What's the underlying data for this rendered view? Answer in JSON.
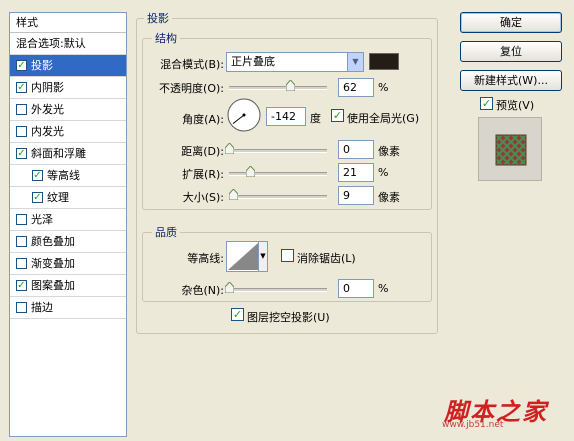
{
  "styles_list": {
    "header": "样式",
    "items": [
      {
        "label": "混合选项:默认",
        "checkbox": false,
        "checked": false,
        "indent": 0,
        "selected": false
      },
      {
        "label": "投影",
        "checkbox": true,
        "checked": true,
        "indent": 0,
        "selected": true
      },
      {
        "label": "内阴影",
        "checkbox": true,
        "checked": true,
        "indent": 0,
        "selected": false
      },
      {
        "label": "外发光",
        "checkbox": true,
        "checked": false,
        "indent": 0,
        "selected": false
      },
      {
        "label": "内发光",
        "checkbox": true,
        "checked": false,
        "indent": 0,
        "selected": false
      },
      {
        "label": "斜面和浮雕",
        "checkbox": true,
        "checked": true,
        "indent": 0,
        "selected": false
      },
      {
        "label": "等高线",
        "checkbox": true,
        "checked": true,
        "indent": 1,
        "selected": false
      },
      {
        "label": "纹理",
        "checkbox": true,
        "checked": true,
        "indent": 1,
        "selected": false
      },
      {
        "label": "光泽",
        "checkbox": true,
        "checked": false,
        "indent": 0,
        "selected": false
      },
      {
        "label": "颜色叠加",
        "checkbox": true,
        "checked": false,
        "indent": 0,
        "selected": false
      },
      {
        "label": "渐变叠加",
        "checkbox": true,
        "checked": false,
        "indent": 0,
        "selected": false
      },
      {
        "label": "图案叠加",
        "checkbox": true,
        "checked": true,
        "indent": 0,
        "selected": false
      },
      {
        "label": "描边",
        "checkbox": true,
        "checked": false,
        "indent": 0,
        "selected": false
      }
    ]
  },
  "drop_shadow": {
    "title": "投影",
    "structure": {
      "title": "结构",
      "blend_mode_label": "混合模式(B):",
      "blend_mode_value": "正片叠底",
      "shadow_color": "#231c17",
      "opacity_label": "不透明度(O):",
      "opacity_value": "62",
      "opacity_unit": "%",
      "angle_label": "角度(A):",
      "angle_value": "-142",
      "angle_unit": "度",
      "global_light_label": "使用全局光(G)",
      "global_light_checked": true,
      "distance_label": "距离(D):",
      "distance_value": "0",
      "distance_unit": "像素",
      "spread_label": "扩展(R):",
      "spread_value": "21",
      "spread_unit": "%",
      "size_label": "大小(S):",
      "size_value": "9",
      "size_unit": "像素"
    },
    "quality": {
      "title": "品质",
      "contour_label": "等高线:",
      "antialias_label": "消除锯齿(L)",
      "antialias_checked": false,
      "noise_label": "杂色(N):",
      "noise_value": "0",
      "noise_unit": "%"
    },
    "knockout_label": "图层挖空投影(U)",
    "knockout_checked": true
  },
  "buttons": {
    "ok": "确定",
    "reset": "复位",
    "new_style": "新建样式(W)...",
    "preview_label": "预览(V)",
    "preview_checked": true
  },
  "watermark": {
    "text": "脚本之家",
    "url": "www.jb51.net"
  },
  "colors": {
    "selection": "#316ac5",
    "group_title": "#0a246a",
    "check": "#21a121"
  }
}
